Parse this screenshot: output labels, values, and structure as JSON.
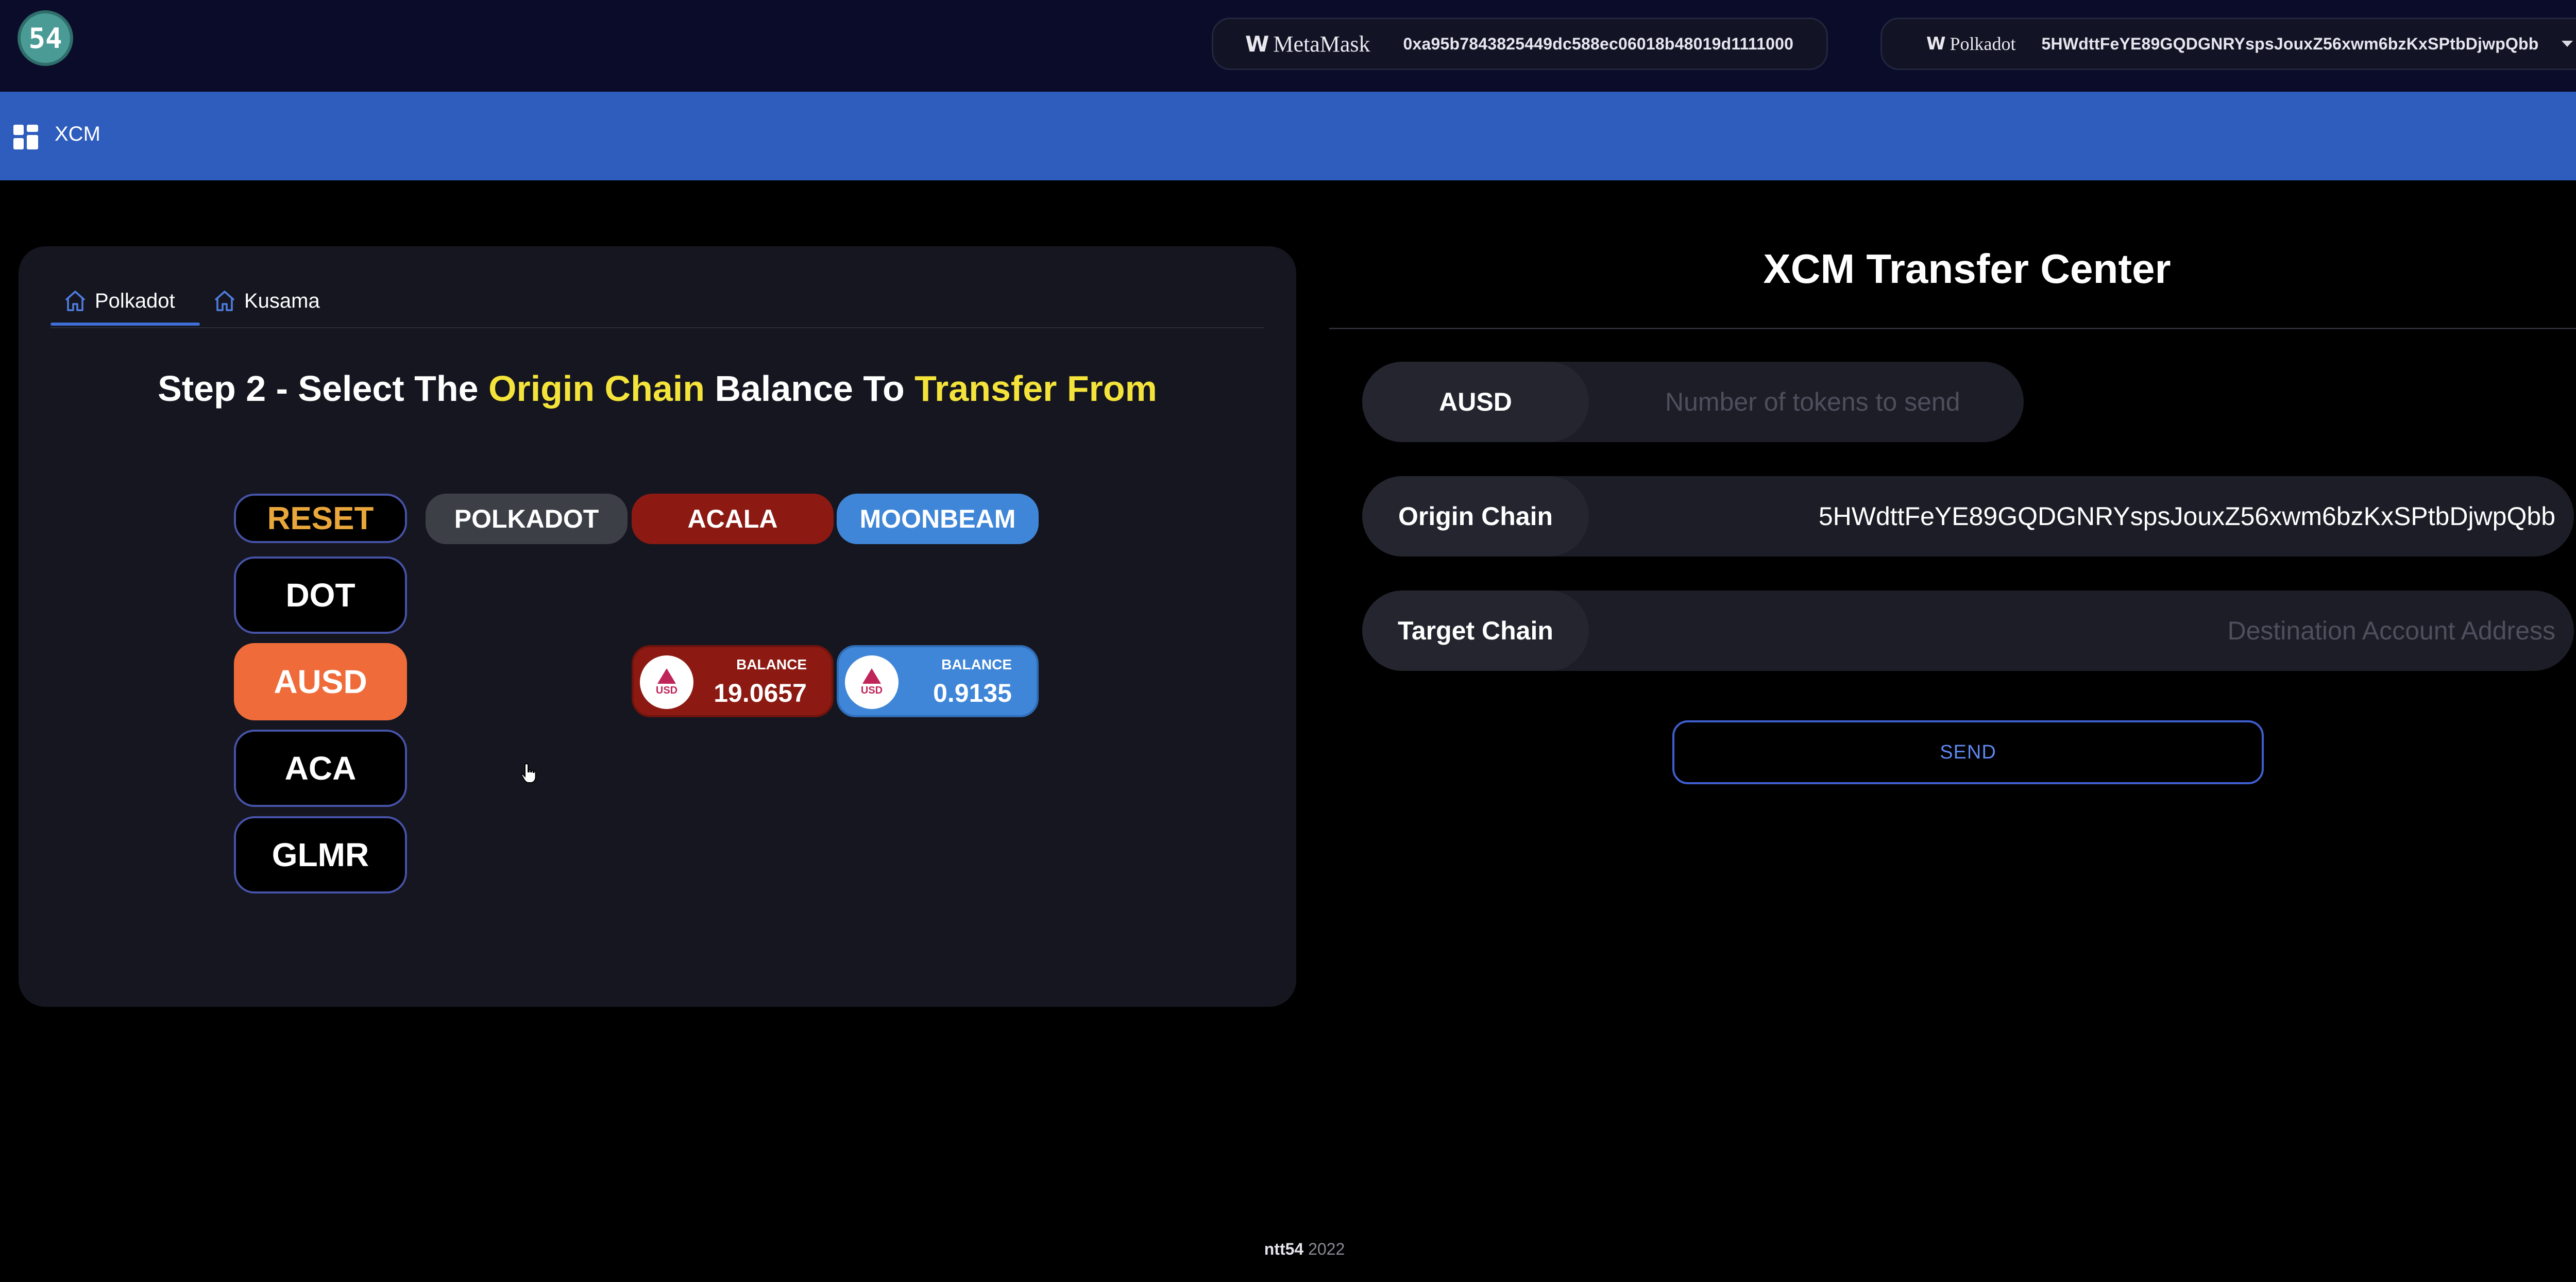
{
  "header": {
    "logo_text": "54",
    "metamask": {
      "brand": "MetaMask",
      "address": "0xa95b7843825449dc588ec06018b48019d1111000"
    },
    "polkadot": {
      "brand": "Polkadot",
      "address": "5HWdttFeYE89GQDGNRYspsJouxZ56xwm6bzKxSPtbDjwpQbb"
    }
  },
  "nav": {
    "title": "XCM"
  },
  "tabs": [
    {
      "label": "Polkadot",
      "active": true
    },
    {
      "label": "Kusama",
      "active": false
    }
  ],
  "step": {
    "prefix": "Step 2 - Select The ",
    "highlight1": "Origin Chain",
    "middle": " Balance To ",
    "highlight2": "Transfer From"
  },
  "tokens": {
    "reset": "RESET",
    "dot": "DOT",
    "ausd": "AUSD",
    "aca": "ACA",
    "glmr": "GLMR"
  },
  "chains": {
    "polkadot": "POLKADOT",
    "acala": "ACALA",
    "moonbeam": "MOONBEAM"
  },
  "balances": {
    "acala": {
      "coin": "USD",
      "label": "BALANCE",
      "value": "19.0657"
    },
    "moonbeam": {
      "coin": "USD",
      "label": "BALANCE",
      "value": "0.9135"
    }
  },
  "transfer": {
    "title": "XCM Transfer Center",
    "token_label": "AUSD",
    "amount_placeholder": "Number of tokens to send",
    "origin_label": "Origin Chain",
    "origin_value": "5HWdttFeYE89GQDGNRYspsJouxZ56xwm6bzKxSPtbDjwpQbb",
    "target_label": "Target Chain",
    "target_placeholder": "Destination Account Address",
    "send_label": "SEND"
  },
  "footer": {
    "brand": "ntt54",
    "year": "2022"
  },
  "colors": {
    "topbar": "#0b0c2a",
    "nav": "#2f5dbd",
    "panel": "#15161f",
    "highlight": "#f4e33a",
    "active_token": "#ef6c3a",
    "acala": "#8c1a12",
    "moonbeam": "#3f86d8"
  }
}
